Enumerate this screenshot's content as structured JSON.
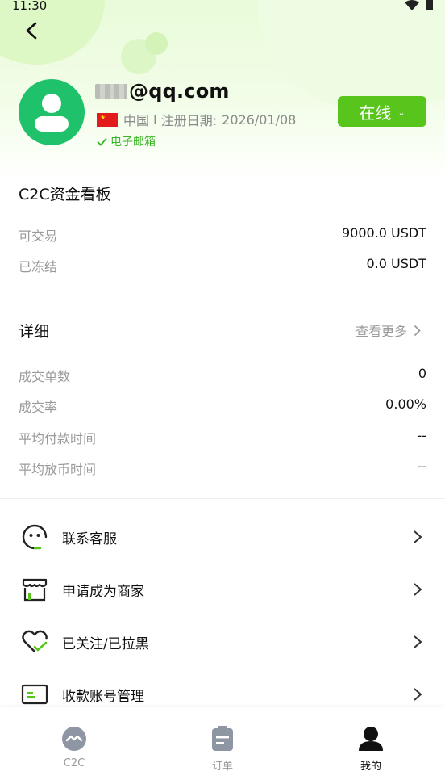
{
  "status_bar": {
    "time": "11:30"
  },
  "profile": {
    "email_visible": "@qq.com",
    "country": "中国",
    "separator": "I",
    "register_label": "注册日期:",
    "register_date": "2026/01/08",
    "verified_label": "电子邮箱",
    "online_label": "在线"
  },
  "funds": {
    "title": "C2C资金看板",
    "rows": [
      {
        "label": "可交易",
        "value": "9000.0 USDT"
      },
      {
        "label": "已冻结",
        "value": "0.0 USDT"
      }
    ]
  },
  "details": {
    "title": "详细",
    "more_label": "查看更多",
    "rows": [
      {
        "label": "成交单数",
        "value": "0"
      },
      {
        "label": "成交率",
        "value": "0.00%"
      },
      {
        "label": "平均付款时间",
        "value": "--"
      },
      {
        "label": "平均放币时间",
        "value": "--"
      }
    ]
  },
  "menu": [
    {
      "label": "联系客服",
      "icon": "customer-service-icon"
    },
    {
      "label": "申请成为商家",
      "icon": "store-icon"
    },
    {
      "label": "已关注/已拉黑",
      "icon": "heart-check-icon"
    },
    {
      "label": "收款账号管理",
      "icon": "payment-card-icon"
    }
  ],
  "tabbar": [
    {
      "label": "C2C",
      "icon": "c2c-icon",
      "active": false
    },
    {
      "label": "订单",
      "icon": "orders-icon",
      "active": false
    },
    {
      "label": "我的",
      "icon": "profile-icon",
      "active": true
    }
  ],
  "colors": {
    "accent": "#57c51b",
    "avatar": "#1fc16b",
    "verified": "#37b523"
  }
}
